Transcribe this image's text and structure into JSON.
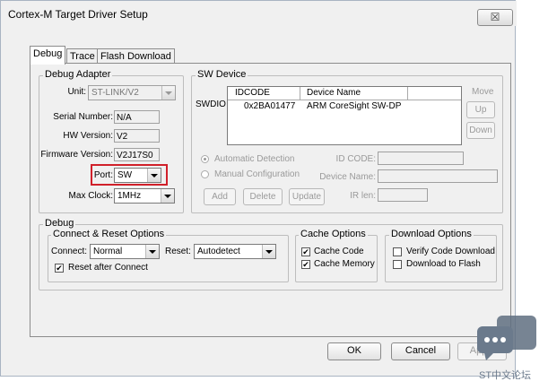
{
  "window": {
    "title": "Cortex-M Target Driver Setup",
    "close_glyph": "☒"
  },
  "tabs": [
    {
      "label": "Debug",
      "active": true
    },
    {
      "label": "Trace",
      "active": false
    },
    {
      "label": "Flash Download",
      "active": false
    }
  ],
  "debug_adapter": {
    "title": "Debug Adapter",
    "unit_label": "Unit:",
    "unit_value": "ST-LINK/V2",
    "serial_label": "Serial Number:",
    "serial_value": "N/A",
    "hw_label": "HW Version:",
    "hw_value": "V2",
    "fw_label": "Firmware Version:",
    "fw_value": "V2J17S0",
    "port_label": "Port:",
    "port_value": "SW",
    "clock_label": "Max Clock:",
    "clock_value": "1MHz"
  },
  "sw_device": {
    "title": "SW Device",
    "row_label": "SWDIO",
    "col_idcode": "IDCODE",
    "col_device": "Device Name",
    "rows": [
      {
        "idcode": "0x2BA01477",
        "device": "ARM CoreSight SW-DP"
      }
    ],
    "move_label": "Move",
    "up_label": "Up",
    "down_label": "Down",
    "auto_detect": "Automatic Detection",
    "manual_config": "Manual Configuration",
    "id_code_label": "ID CODE:",
    "device_name_label": "Device Name:",
    "ir_len_label": "IR len:",
    "add_label": "Add",
    "delete_label": "Delete",
    "update_label": "Update"
  },
  "debug": {
    "title": "Debug",
    "connect_reset_title": "Connect & Reset Options",
    "connect_label": "Connect:",
    "connect_value": "Normal",
    "reset_label": "Reset:",
    "reset_value": "Autodetect",
    "reset_after_connect": "Reset after Connect",
    "reset_after_connect_checked": true,
    "cache_title": "Cache Options",
    "cache_code": "Cache Code",
    "cache_code_checked": true,
    "cache_memory": "Cache Memory",
    "cache_memory_checked": true,
    "download_title": "Download Options",
    "verify_code": "Verify Code Download",
    "verify_checked": false,
    "download_flash": "Download to Flash",
    "download_checked": false
  },
  "footer": {
    "ok": "OK",
    "cancel": "Cancel",
    "apply": "Apply"
  },
  "watermark": {
    "text": "ST中文论坛",
    "icon": "chat-bubble-icon"
  },
  "colors": {
    "highlight": "#d0202a",
    "dialog_bg": "#f0f0f0",
    "watermark": "#6b7a8c"
  }
}
